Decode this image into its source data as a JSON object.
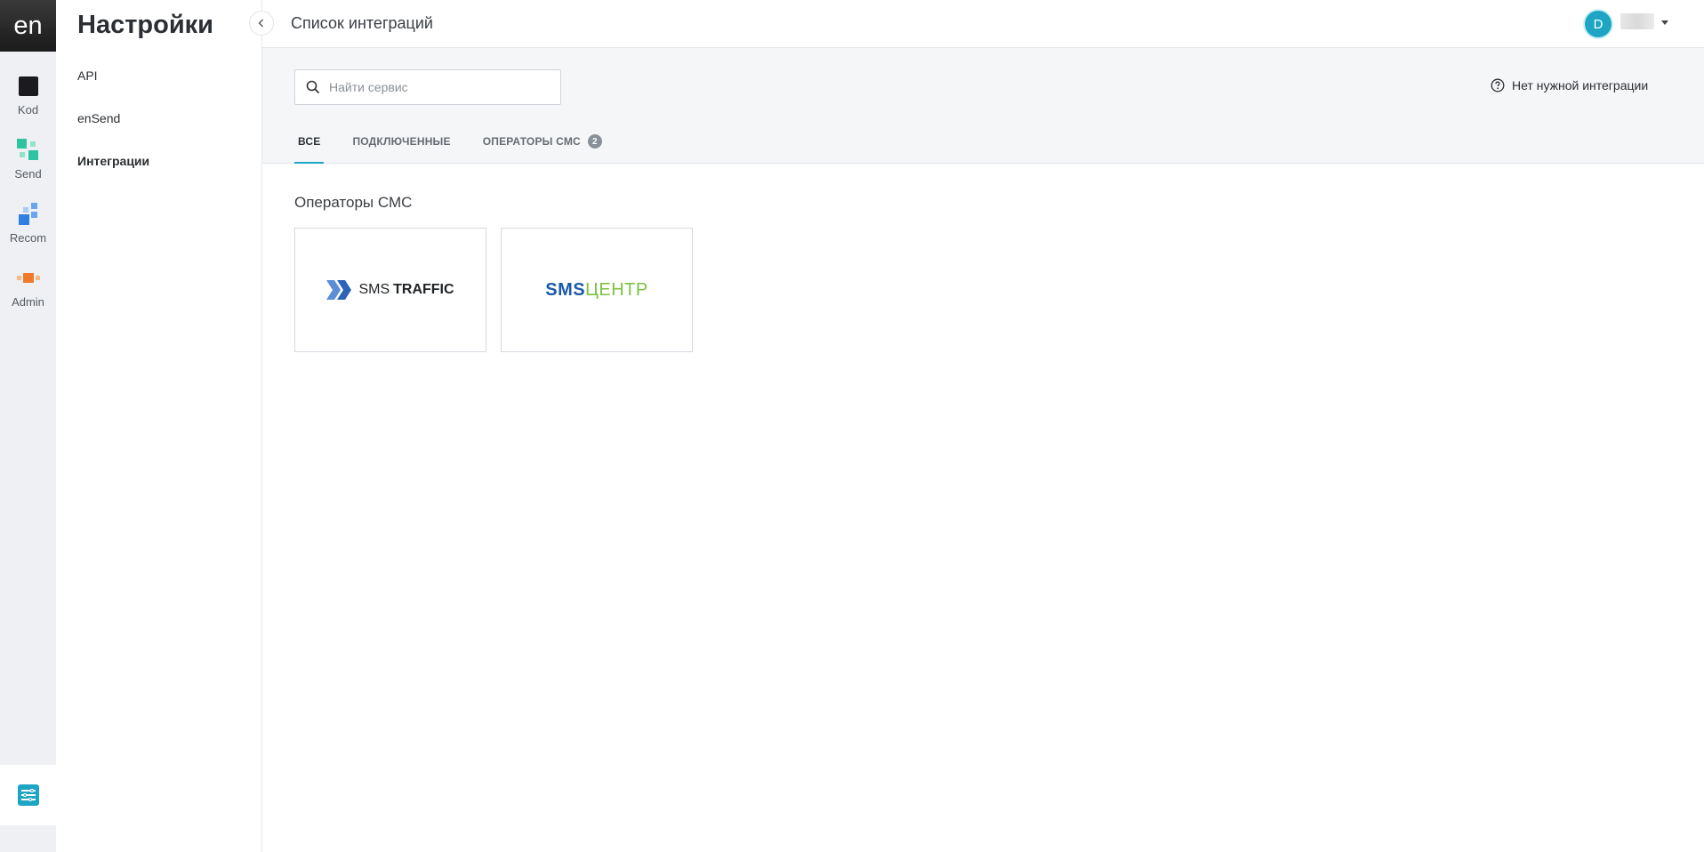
{
  "rail": {
    "logo": "en",
    "items": [
      {
        "label": "Kod"
      },
      {
        "label": "Send"
      },
      {
        "label": "Recom"
      },
      {
        "label": "Admin"
      }
    ]
  },
  "sidebar": {
    "title": "Настройки",
    "links": [
      {
        "label": "API"
      },
      {
        "label": "enSend"
      },
      {
        "label": "Интеграции"
      }
    ]
  },
  "header": {
    "title": "Список интеграций",
    "avatar_initial": "D"
  },
  "toolbar": {
    "search_placeholder": "Найти сервис",
    "help_label": "Нет нужной интеграции"
  },
  "tabs": [
    {
      "label": "ВСЕ"
    },
    {
      "label": "ПОДКЛЮЧЕННЫЕ"
    },
    {
      "label": "ОПЕРАТОРЫ СМС",
      "count": "2"
    }
  ],
  "section": {
    "title": "Операторы СМС",
    "cards": [
      {
        "logo_text_a": "SMS",
        "logo_text_b": "TRAFFIC"
      },
      {
        "logo_text_a": "SMS",
        "logo_text_b": "ЦЕНТР"
      }
    ]
  },
  "colors": {
    "accent": "#1ea5c4",
    "rail_bg": "#eef0f3",
    "band_bg": "#f5f6f8"
  }
}
